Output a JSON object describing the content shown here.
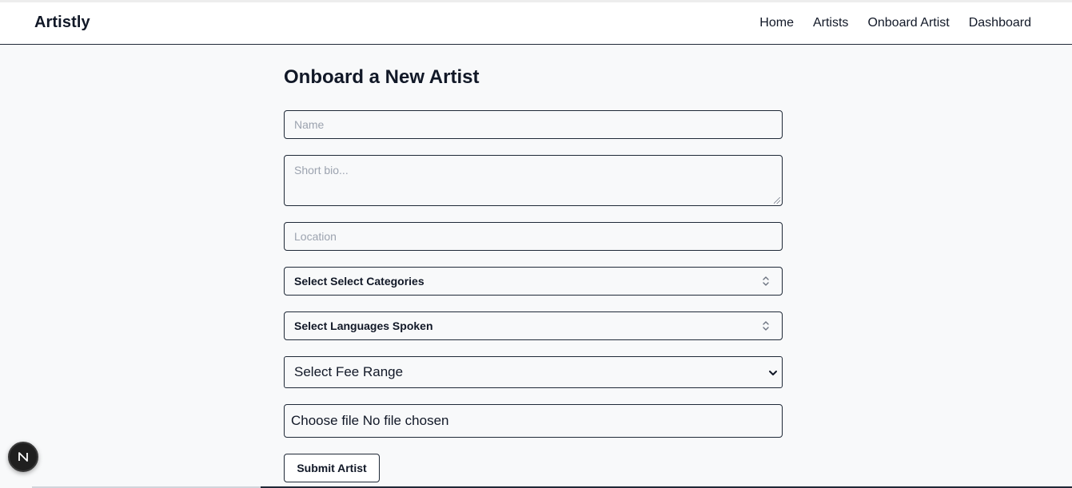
{
  "brand": "Artistly",
  "nav": {
    "home": "Home",
    "artists": "Artists",
    "onboard": "Onboard Artist",
    "dashboard": "Dashboard"
  },
  "form": {
    "title": "Onboard a New Artist",
    "name_placeholder": "Name",
    "bio_placeholder": "Short bio...",
    "location_placeholder": "Location",
    "categories_label": "Select Select Categories",
    "languages_label": "Select Languages Spoken",
    "fee_label": "Select Fee Range",
    "file_label": "Choose file No file chosen",
    "submit_label": "Submit Artist"
  },
  "icons": {
    "select_arrows": "chevron-up-down-icon",
    "dropdown": "chevron-down-icon",
    "dev_badge": "next-n-icon"
  }
}
